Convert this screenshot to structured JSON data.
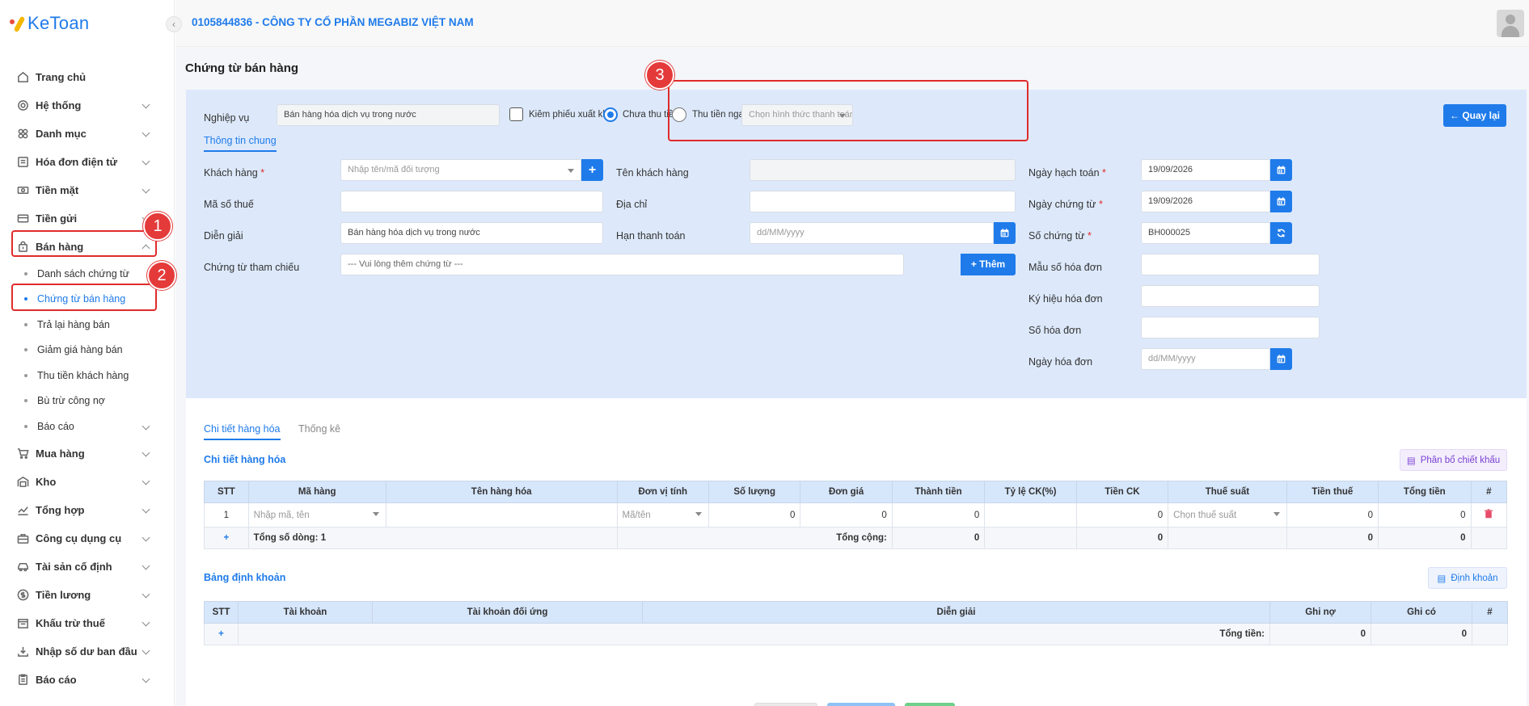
{
  "app": {
    "logo_text": "KeToan"
  },
  "header": {
    "company": "0105844836 - CÔNG TY CỔ PHẦN MEGABIZ VIỆT NAM"
  },
  "sidebar": {
    "items": [
      {
        "label": "Trang chủ",
        "icon": "home-icon"
      },
      {
        "label": "Hệ thống",
        "icon": "gear-icon"
      },
      {
        "label": "Danh mục",
        "icon": "grid-icon"
      },
      {
        "label": "Hóa đơn điện tử",
        "icon": "invoice-icon"
      },
      {
        "label": "Tiền mặt",
        "icon": "cash-icon"
      },
      {
        "label": "Tiền gửi",
        "icon": "bank-card-icon"
      },
      {
        "label": "Bán hàng",
        "icon": "shopping-bag-icon"
      }
    ],
    "sub_items": [
      "Danh sách chứng từ",
      "Chứng từ bán hàng",
      "Trả lại hàng bán",
      "Giảm giá hàng bán",
      "Thu tiền khách hàng",
      "Bù trừ công nợ",
      "Báo cáo"
    ],
    "items_after": [
      {
        "label": "Mua hàng",
        "icon": "cart-icon"
      },
      {
        "label": "Kho",
        "icon": "warehouse-icon"
      },
      {
        "label": "Tổng hợp",
        "icon": "chart-icon"
      },
      {
        "label": "Công cụ dụng cụ",
        "icon": "tools-icon"
      },
      {
        "label": "Tài sản cố định",
        "icon": "car-icon"
      },
      {
        "label": "Tiền lương",
        "icon": "dollar-icon"
      },
      {
        "label": "Khấu trừ thuế",
        "icon": "tax-icon"
      },
      {
        "label": "Nhập số dư ban đầu",
        "icon": "import-icon"
      },
      {
        "label": "Báo cáo",
        "icon": "report-icon"
      }
    ]
  },
  "annotations": {
    "b1": "1",
    "b2": "2",
    "b3": "3"
  },
  "page": {
    "title": "Chứng từ bán hàng"
  },
  "form": {
    "nghiep_vu_label": "Nghiệp vụ",
    "nghiep_vu_value": "Bán hàng hóa dịch vụ trong nước",
    "kiem_phieu_label": "Kiêm phiếu xuất kho",
    "chua_thu_tien": "Chưa thu tiền",
    "thu_tien_ngay": "Thu tiền ngay",
    "payment_placeholder": "Chọn hình thức thanh toán",
    "back_button": "Quay lại",
    "tab_general": "Thông tin chung",
    "khach_hang_label": "Khách hàng",
    "khach_hang_placeholder": "Nhập tên/mã đối tượng",
    "ten_kh_label": "Tên khách hàng",
    "mst_label": "Mã số thuế",
    "dia_chi_label": "Địa chỉ",
    "dien_giai_label": "Diễn giải",
    "dien_giai_value": "Bán hàng hóa dịch vụ trong nước",
    "han_tt_label": "Hạn thanh toán",
    "date_placeholder": "dd/MM/yyyy",
    "ct_tham_chieu_label": "Chứng từ tham chiếu",
    "ct_tham_chieu_placeholder": "--- Vui lòng thêm chứng từ ---",
    "them_button": "Thêm",
    "ngay_hach_toan_label": "Ngày hạch toán",
    "ngay_hach_toan_value": "19/09/2026",
    "ngay_chung_tu_label": "Ngày chứng từ",
    "ngay_chung_tu_value": "19/09/2026",
    "so_chung_tu_label": "Số chứng từ",
    "so_chung_tu_value": "BH000025",
    "mau_so_label": "Mẫu số hóa đơn",
    "ky_hieu_label": "Ký hiệu hóa đơn",
    "so_hd_label": "Số hóa đơn",
    "ngay_hd_label": "Ngày hóa đơn",
    "required_mark": "*"
  },
  "detail": {
    "tab1": "Chi tiết hàng hóa",
    "tab2": "Thống kê",
    "section_title": "Chi tiết hàng hóa",
    "phan_bo_button": "Phân bổ chiết khấu",
    "columns": [
      "STT",
      "Mã hàng",
      "Tên hàng hóa",
      "Đơn vị tính",
      "Số lượng",
      "Đơn giá",
      "Thành tiền",
      "Tỷ lệ CK(%)",
      "Tiền CK",
      "Thuế suất",
      "Tiền thuế",
      "Tổng tiền",
      "#"
    ],
    "row": {
      "stt": "1",
      "ma_hang_ph": "Nhập mã, tên",
      "dvt_ph": "Mã/tên",
      "so_luong": "0",
      "don_gia": "0",
      "thanh_tien": "0",
      "tien_ck": "0",
      "thue_suat_ph": "Chọn thuế suất",
      "tien_thue": "0",
      "tong_tien": "0"
    },
    "footer": {
      "plus": "+",
      "total_rows": "Tổng số dòng: 1",
      "tong_cong": "Tổng cộng:",
      "thanh_tien": "0",
      "tien_ck": "0",
      "tien_thue": "0",
      "tong_tien": "0"
    }
  },
  "accounting": {
    "section_title": "Bảng định khoản",
    "dinh_khoan_button": "Định khoản",
    "columns": [
      "STT",
      "Tài khoản",
      "Tài khoản đối ứng",
      "Diễn giải",
      "Ghi nợ",
      "Ghi có",
      "#"
    ],
    "footer": {
      "plus": "+",
      "tong_tien": "Tổng tiền:",
      "ghi_no": "0",
      "ghi_co": "0"
    }
  },
  "colors": {
    "accent": "#1f7bea",
    "annotation": "#e02b2b",
    "panel": "#dde9fb"
  }
}
